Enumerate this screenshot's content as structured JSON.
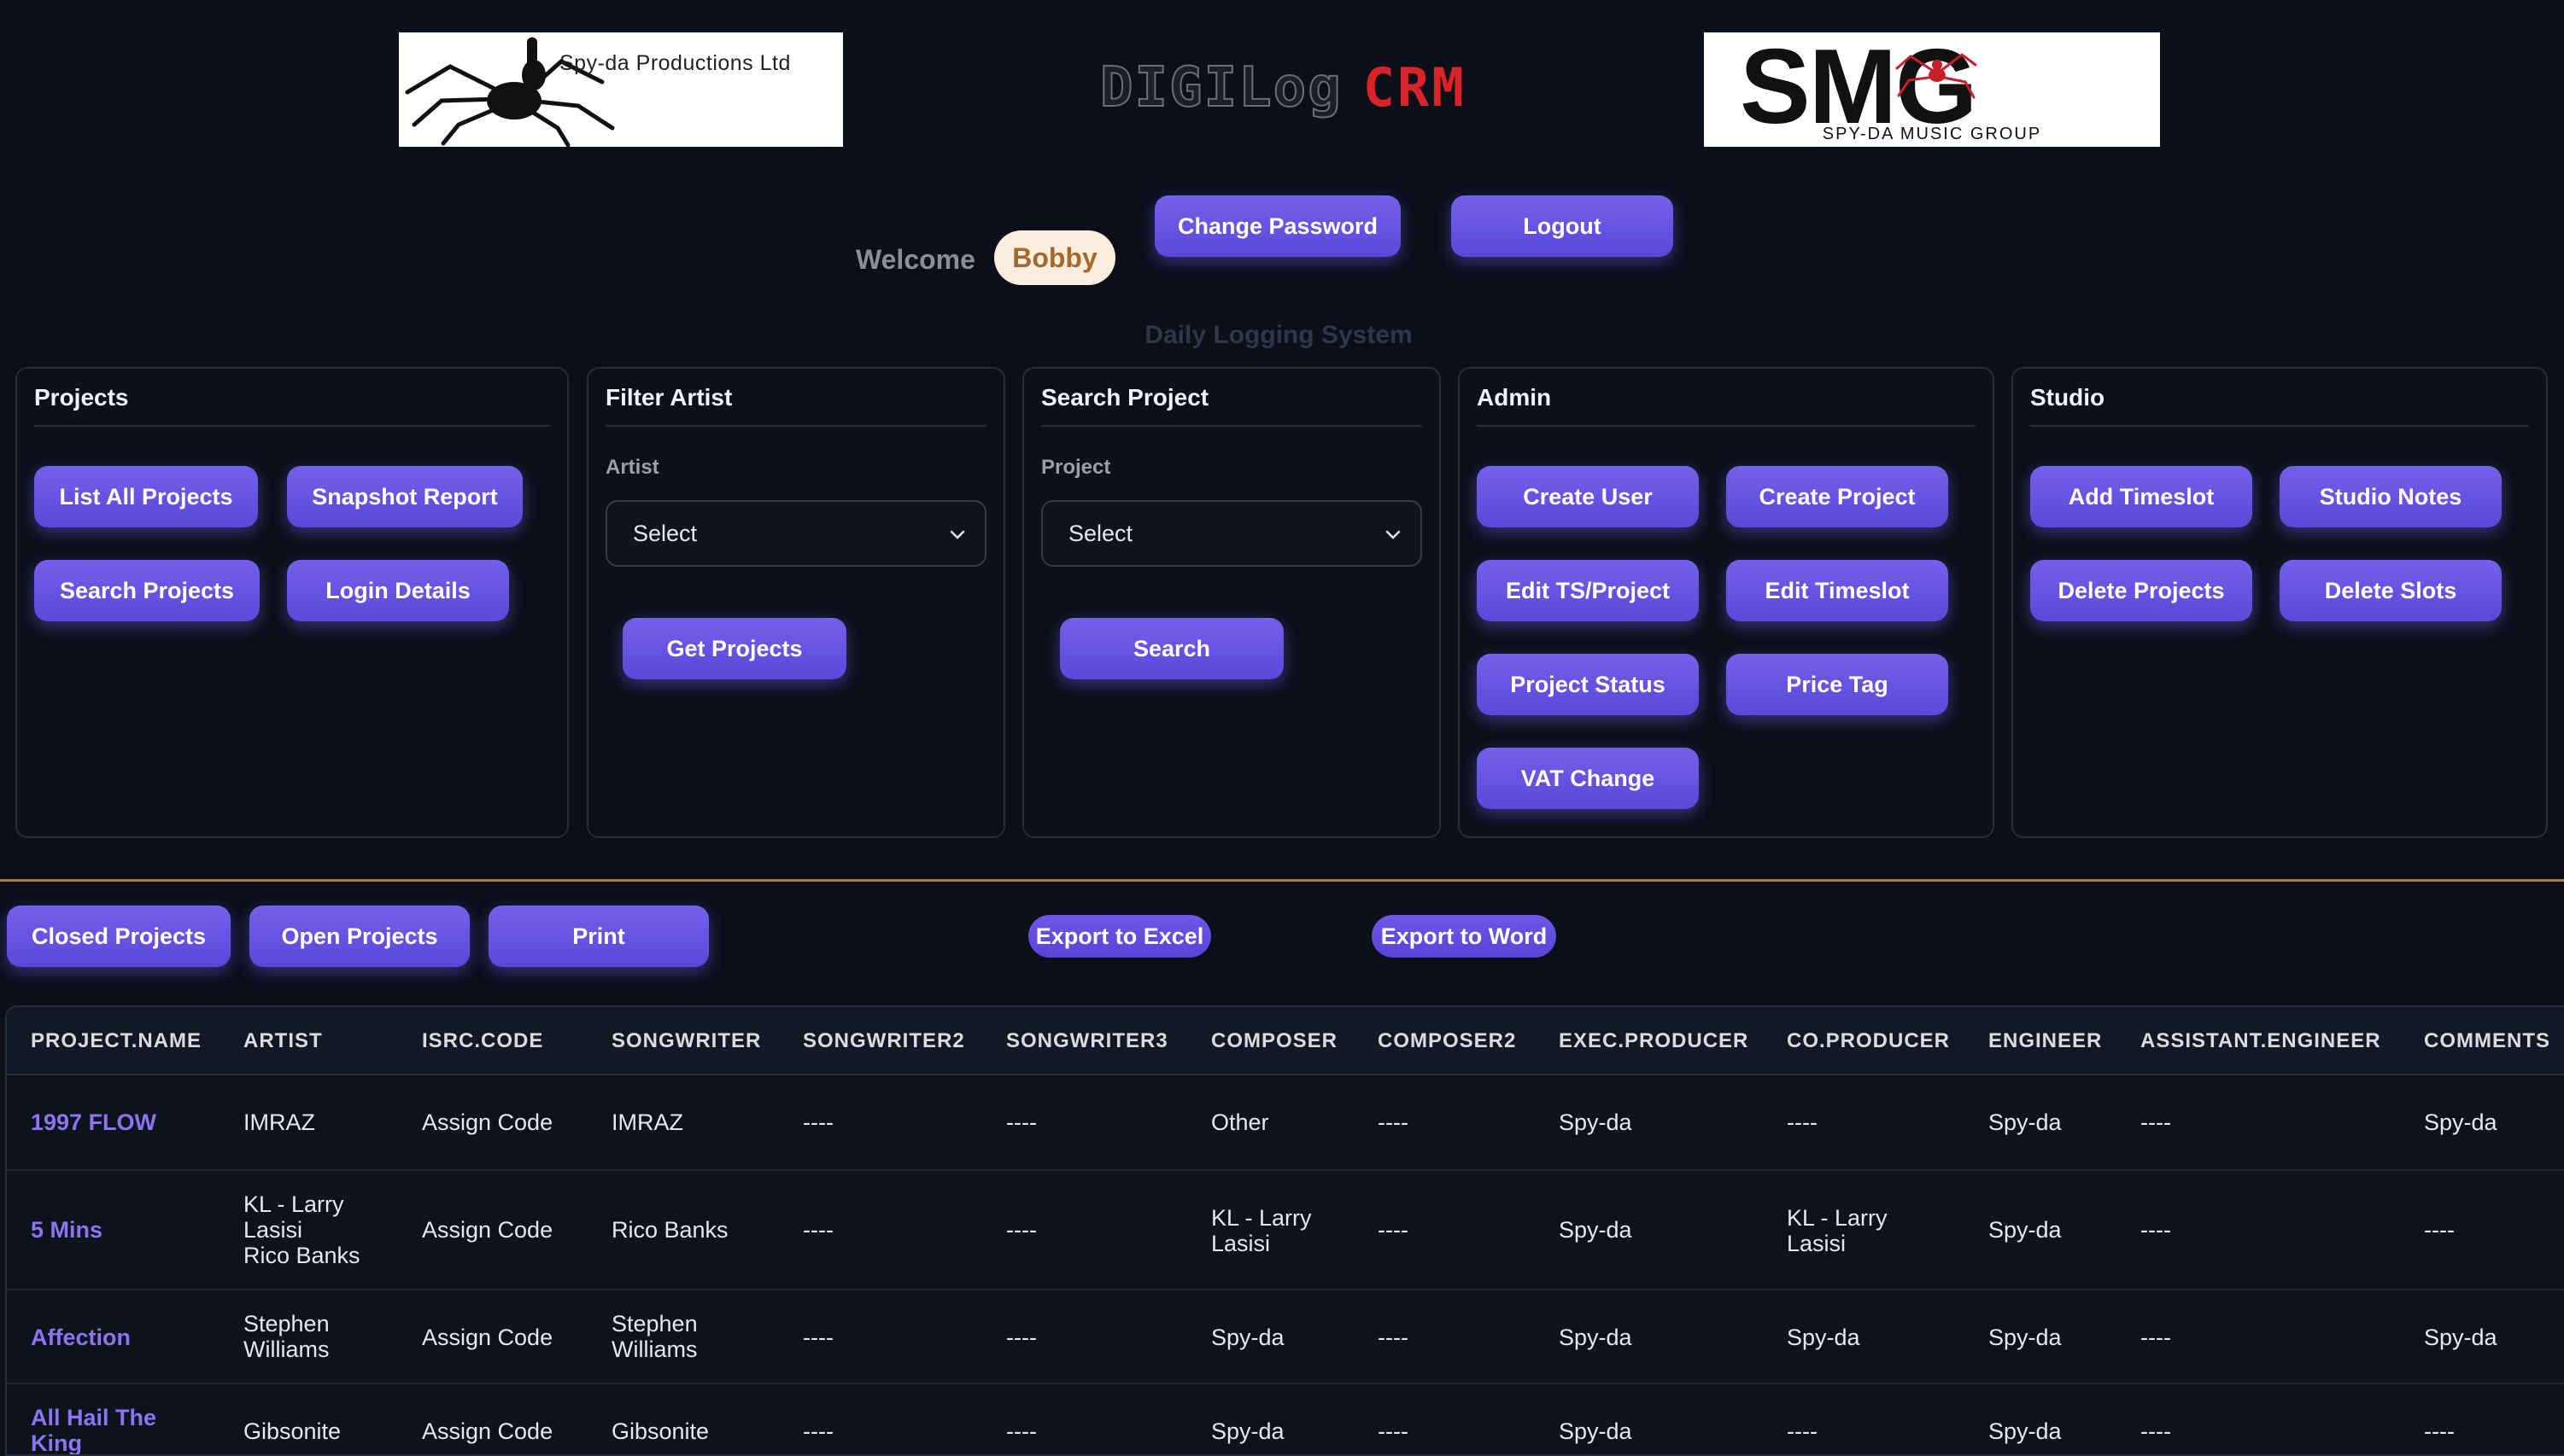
{
  "header": {
    "logo_left_text": "Spy-da Productions Ltd",
    "logo_center_part1": "DIGILog",
    "logo_center_part2": "CRM",
    "logo_right_big": "SMG",
    "logo_right_small": "SPY-DA MUSIC GROUP",
    "welcome_label": "Welcome",
    "username": "Bobby",
    "change_password_label": "Change Password",
    "logout_label": "Logout",
    "subtitle": "Daily Logging System"
  },
  "panels": {
    "projects": {
      "title": "Projects",
      "buttons": [
        "List All Projects",
        "Snapshot Report",
        "Search Projects",
        "Login Details"
      ]
    },
    "filter_artist": {
      "title": "Filter Artist",
      "field_label": "Artist",
      "select_value": "Select",
      "button": "Get Projects"
    },
    "search_project": {
      "title": "Search Project",
      "field_label": "Project",
      "select_value": "Select",
      "button": "Search"
    },
    "admin": {
      "title": "Admin",
      "buttons": [
        "Create User",
        "Create Project",
        "Edit TS/Project",
        "Edit Timeslot",
        "Project Status",
        "Price Tag",
        "VAT Change"
      ]
    },
    "studio": {
      "title": "Studio",
      "buttons": [
        "Add Timeslot",
        "Studio Notes",
        "Delete Projects",
        "Delete Slots"
      ]
    }
  },
  "toolbar": {
    "closed_projects": "Closed Projects",
    "open_projects": "Open Projects",
    "print": "Print",
    "export_excel": "Export to Excel",
    "export_word": "Export to Word"
  },
  "table": {
    "columns": [
      "PROJECT.NAME",
      "ARTIST",
      "ISRC.CODE",
      "SONGWRITER",
      "SONGWRITER2",
      "SONGWRITER3",
      "COMPOSER",
      "COMPOSER2",
      "EXEC.PRODUCER",
      "CO.PRODUCER",
      "ENGINEER",
      "ASSISTANT.ENGINEER",
      "COMMENTS"
    ],
    "rows": [
      {
        "project_name": [
          "1997 FLOW"
        ],
        "artist": [
          "IMRAZ"
        ],
        "isrc_code": [
          "Assign Code"
        ],
        "songwriter": [
          "IMRAZ"
        ],
        "songwriter2": [
          "----"
        ],
        "songwriter3": [
          "----"
        ],
        "composer": [
          "Other"
        ],
        "composer2": [
          "----"
        ],
        "exec_producer": [
          "Spy-da"
        ],
        "co_producer": [
          "----"
        ],
        "engineer": [
          "Spy-da"
        ],
        "assistant_engineer": [
          "----"
        ],
        "comments": [
          "Spy-da"
        ]
      },
      {
        "project_name": [
          "5 Mins"
        ],
        "artist": [
          "KL - Larry",
          "Lasisi",
          "Rico Banks"
        ],
        "isrc_code": [
          "Assign Code"
        ],
        "songwriter": [
          "Rico Banks"
        ],
        "songwriter2": [
          "----"
        ],
        "songwriter3": [
          "----"
        ],
        "composer": [
          "KL - Larry",
          "Lasisi"
        ],
        "composer2": [
          "----"
        ],
        "exec_producer": [
          "Spy-da"
        ],
        "co_producer": [
          "KL - Larry",
          "Lasisi"
        ],
        "engineer": [
          "Spy-da"
        ],
        "assistant_engineer": [
          "----"
        ],
        "comments": [
          "----"
        ]
      },
      {
        "project_name": [
          "Affection"
        ],
        "artist": [
          "Stephen",
          "Williams"
        ],
        "isrc_code": [
          "Assign Code"
        ],
        "songwriter": [
          "Stephen",
          "Williams"
        ],
        "songwriter2": [
          "----"
        ],
        "songwriter3": [
          "----"
        ],
        "composer": [
          "Spy-da"
        ],
        "composer2": [
          "----"
        ],
        "exec_producer": [
          "Spy-da"
        ],
        "co_producer": [
          "Spy-da"
        ],
        "engineer": [
          "Spy-da"
        ],
        "assistant_engineer": [
          "----"
        ],
        "comments": [
          "Spy-da"
        ]
      },
      {
        "project_name": [
          "All Hail The",
          "King"
        ],
        "artist": [
          "Gibsonite"
        ],
        "isrc_code": [
          "Assign Code"
        ],
        "songwriter": [
          "Gibsonite"
        ],
        "songwriter2": [
          "----"
        ],
        "songwriter3": [
          "----"
        ],
        "composer": [
          "Spy-da"
        ],
        "composer2": [
          "----"
        ],
        "exec_producer": [
          "Spy-da"
        ],
        "co_producer": [
          "----"
        ],
        "engineer": [
          "Spy-da"
        ],
        "assistant_engineer": [
          "----"
        ],
        "comments": [
          "----"
        ]
      }
    ]
  },
  "colors": {
    "background": "#0a0f1a",
    "button": "#6a55e6",
    "link": "#8c74f5",
    "accent_rule": "#b07a30",
    "user_pill": "#fbeede",
    "crm_red": "#d8232a"
  }
}
